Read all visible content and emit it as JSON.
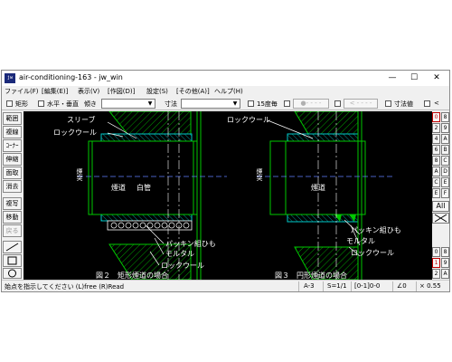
{
  "window": {
    "icon_text": "jw",
    "title": "air-conditioning-163 - jw_win",
    "controls": {
      "minimize": "—",
      "maximize": "☐",
      "close": "✕"
    }
  },
  "menu": [
    "ファイル(F)",
    "[編集(E)]",
    "表示(V)",
    "[作図(D)]",
    "設定(S)",
    "[その他(A)]",
    "ヘルプ(H)"
  ],
  "toolbar": {
    "rect_label": "矩形",
    "horiz_label": "水平・垂直",
    "slope_label": "傾き",
    "slope_value": "",
    "dim_label": "寸法",
    "dim_value": "",
    "every15_label": "15度毎",
    "line_style_btn": "●- - - -",
    "arrow_btn": "< - - - -",
    "dim_value_label": "寸法値",
    "extra_label": "<"
  },
  "left_tools": [
    "範囲",
    "複線",
    "ｺｰﾅｰ",
    "伸縮",
    "面取",
    "消去",
    "複写",
    "移動",
    "戻る"
  ],
  "right_tools": {
    "layer_groups_left": [
      "0",
      "2",
      "4",
      "6",
      "8",
      "A",
      "C",
      "E"
    ],
    "layer_groups_right": [
      "8",
      "9",
      "A",
      "B",
      "C",
      "D",
      "E",
      "F"
    ],
    "all_label": "All",
    "bottom_left": [
      "0",
      "1",
      "2"
    ],
    "bottom_right": [
      "8",
      "9",
      "A"
    ]
  },
  "drawing": {
    "fig2": {
      "labels": {
        "sleeve": "スリーブ",
        "rockwool_top": "ロックウール",
        "flue_vertical": "煙突",
        "flue_passage": "煙道",
        "white_pipe": "白管",
        "packing": "パッキン組ひも",
        "mortar": "モルタル",
        "rockwool_bottom": "ロックウール"
      },
      "caption": "図２　矩形煙道の場合"
    },
    "fig3": {
      "labels": {
        "rockwool_top": "ロックウール",
        "flue_vertical": "煙突",
        "flue_passage": "煙道",
        "packing": "パッキン組ひも",
        "mortar": "モルタル",
        "rockwool_bottom": "ロックウール"
      },
      "caption": "図３　円形煙道の場合"
    },
    "colors": {
      "background": "#000000",
      "green": "#00c800",
      "cyan": "#00c8c8",
      "white": "#ffffff",
      "dash_blue": "#6080ff"
    }
  },
  "status": {
    "message": "始点を指示してください (L)free (R)Read",
    "paper": "A-3",
    "scale": "S=1/1",
    "layer": "[0-1]0-0",
    "angle": "∠0",
    "zoom": "× 0.55"
  }
}
